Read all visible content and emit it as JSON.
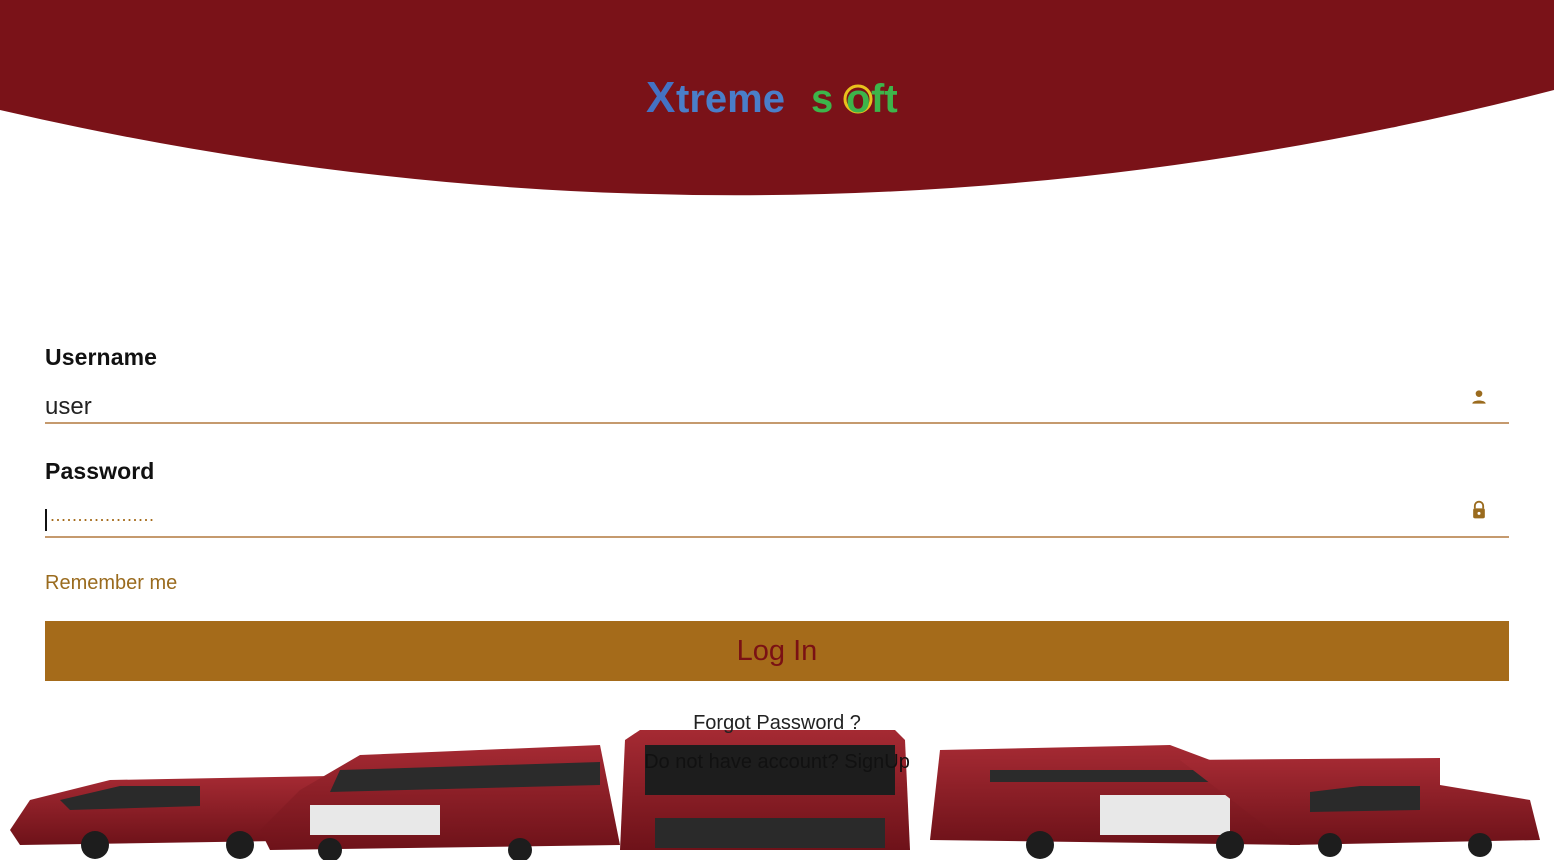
{
  "brand": {
    "logo_text": "Xtremesoft",
    "header_color": "#7a1218",
    "accent_color": "#a56b1a"
  },
  "login_form": {
    "username": {
      "label": "Username",
      "value": "user",
      "icon": "person-icon"
    },
    "password": {
      "label": "Password",
      "masked_value": "...................",
      "icon": "lock-icon"
    },
    "remember_label": "Remember me",
    "submit_label": "Log In"
  },
  "links": {
    "forgot_password": "Forgot Password ?",
    "signup_prompt": "Do not have account?",
    "signup_link": "SignUp"
  }
}
